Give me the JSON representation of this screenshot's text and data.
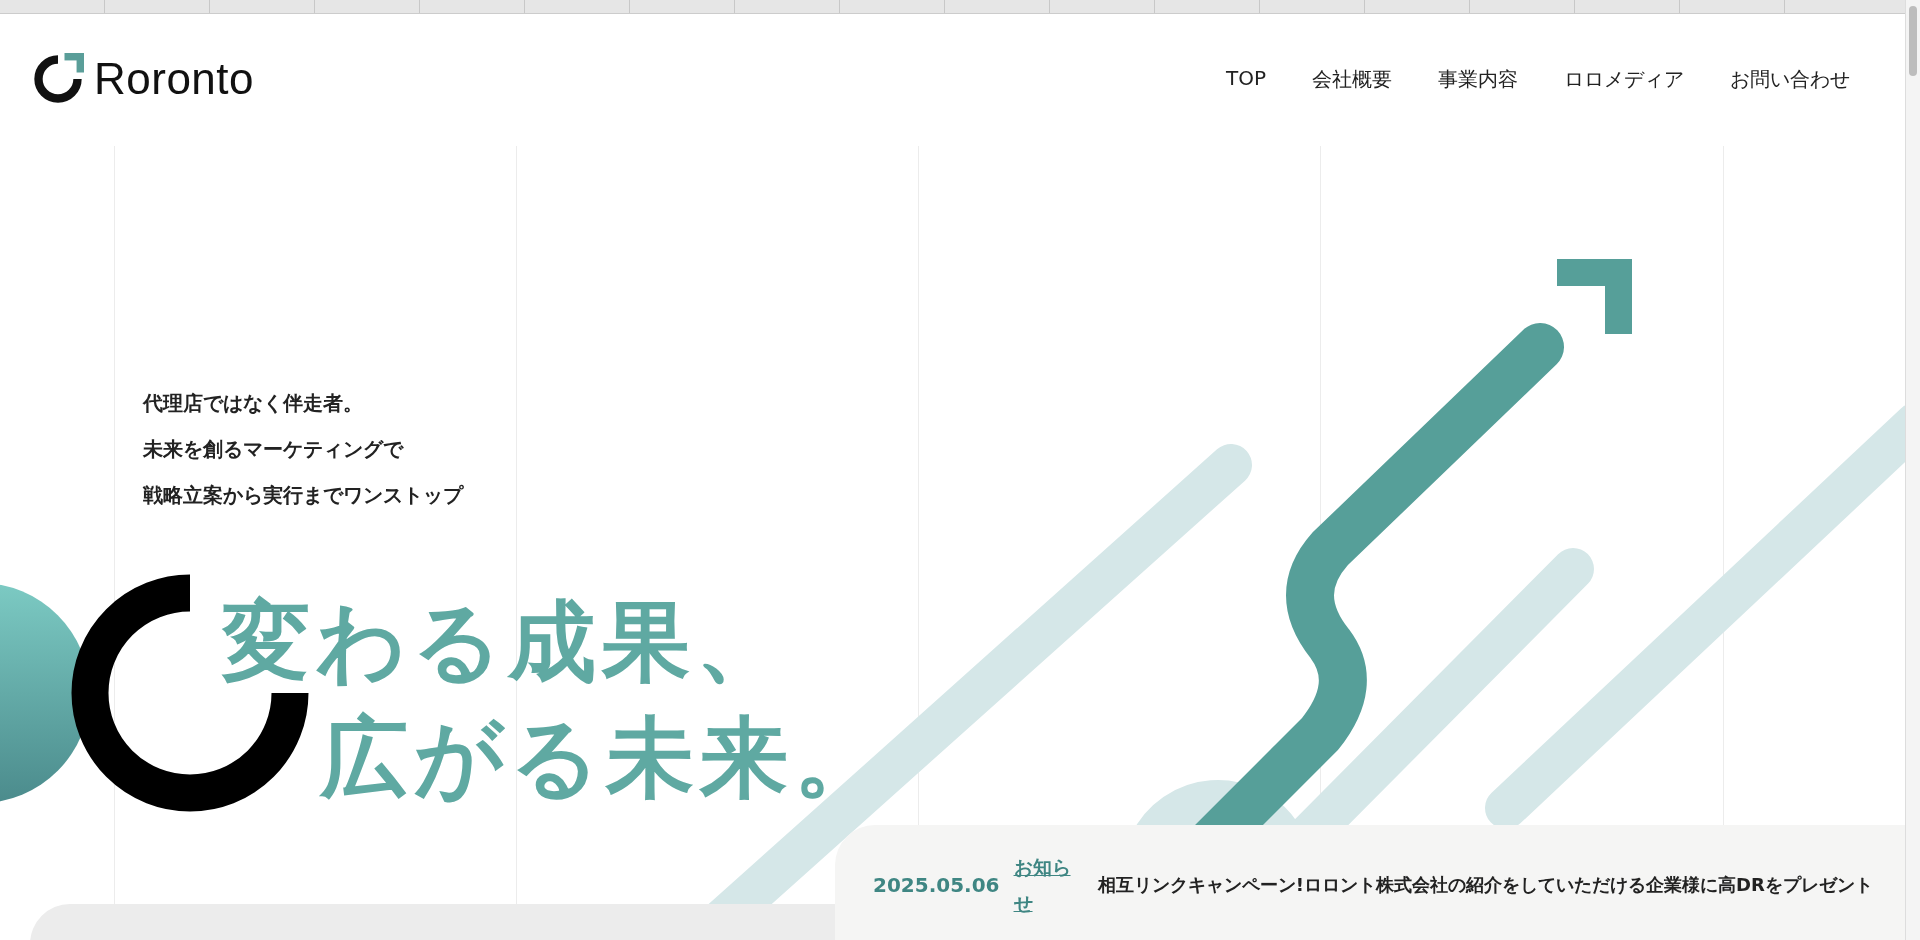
{
  "header": {
    "logo_text": "Roronto",
    "nav": [
      "TOP",
      "会社概要",
      "事業内容",
      "ロロメディア",
      "お問い合わせ"
    ]
  },
  "hero": {
    "tagline": [
      "代理店ではなく伴走者。",
      "未来を創るマーケティングで",
      "戦略立案から実行までワンストップ"
    ],
    "headline": [
      "変わる成果、",
      "広がる未来。"
    ]
  },
  "news": {
    "date": "2025.05.06",
    "category": "お知らせ",
    "text": "相互リンクキャンペーン!ロロント株式会社の紹介をしていただける企業様に高DRをプレゼント"
  }
}
